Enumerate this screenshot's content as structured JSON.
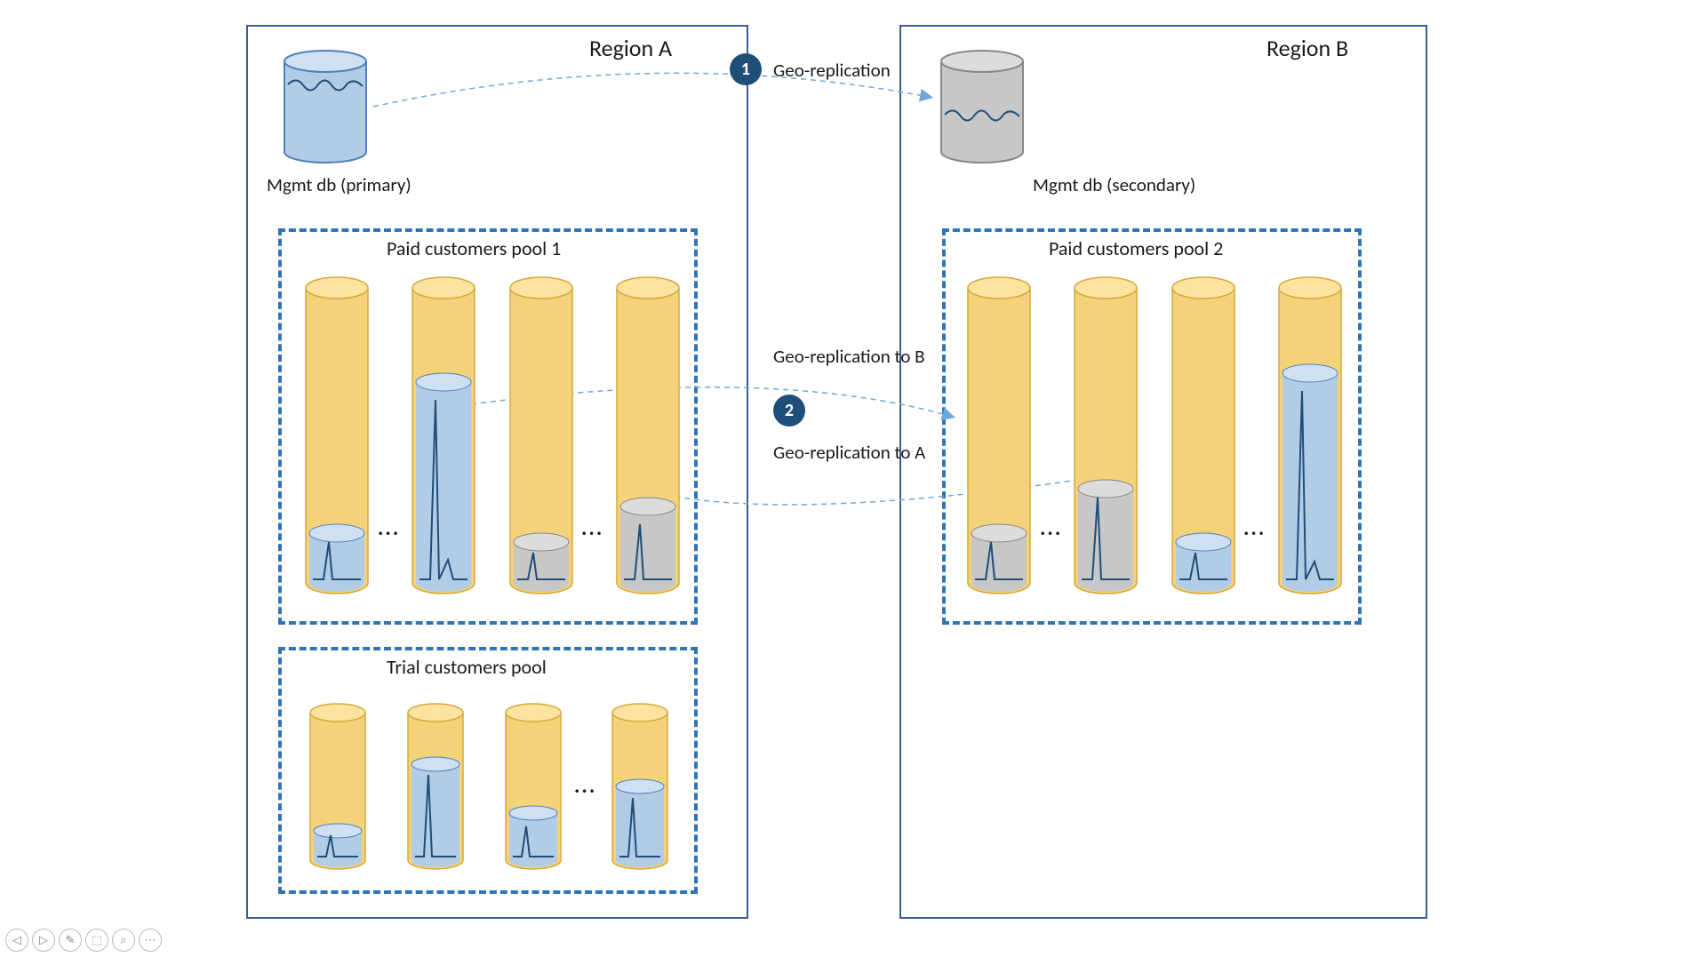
{
  "regionA": {
    "title": "Region A"
  },
  "regionB": {
    "title": "Region B"
  },
  "mgmt": {
    "primary": "Mgmt db (primary)",
    "secondary": "Mgmt db (secondary)"
  },
  "pools": {
    "paid1": "Paid customers pool 1",
    "trial": "Trial customers pool",
    "paid2": "Paid customers pool 2"
  },
  "repl": {
    "main": "Geo-replication",
    "toB": "Geo-replication to B",
    "toA": "Geo-replication to A"
  },
  "badges": {
    "one": "1",
    "two": "2"
  },
  "dots": "...",
  "toolbar": {
    "prev": "◁",
    "next": "▷",
    "pen": "✎",
    "eraser": "⬚",
    "zoom": "⌕",
    "more": "⋯"
  }
}
